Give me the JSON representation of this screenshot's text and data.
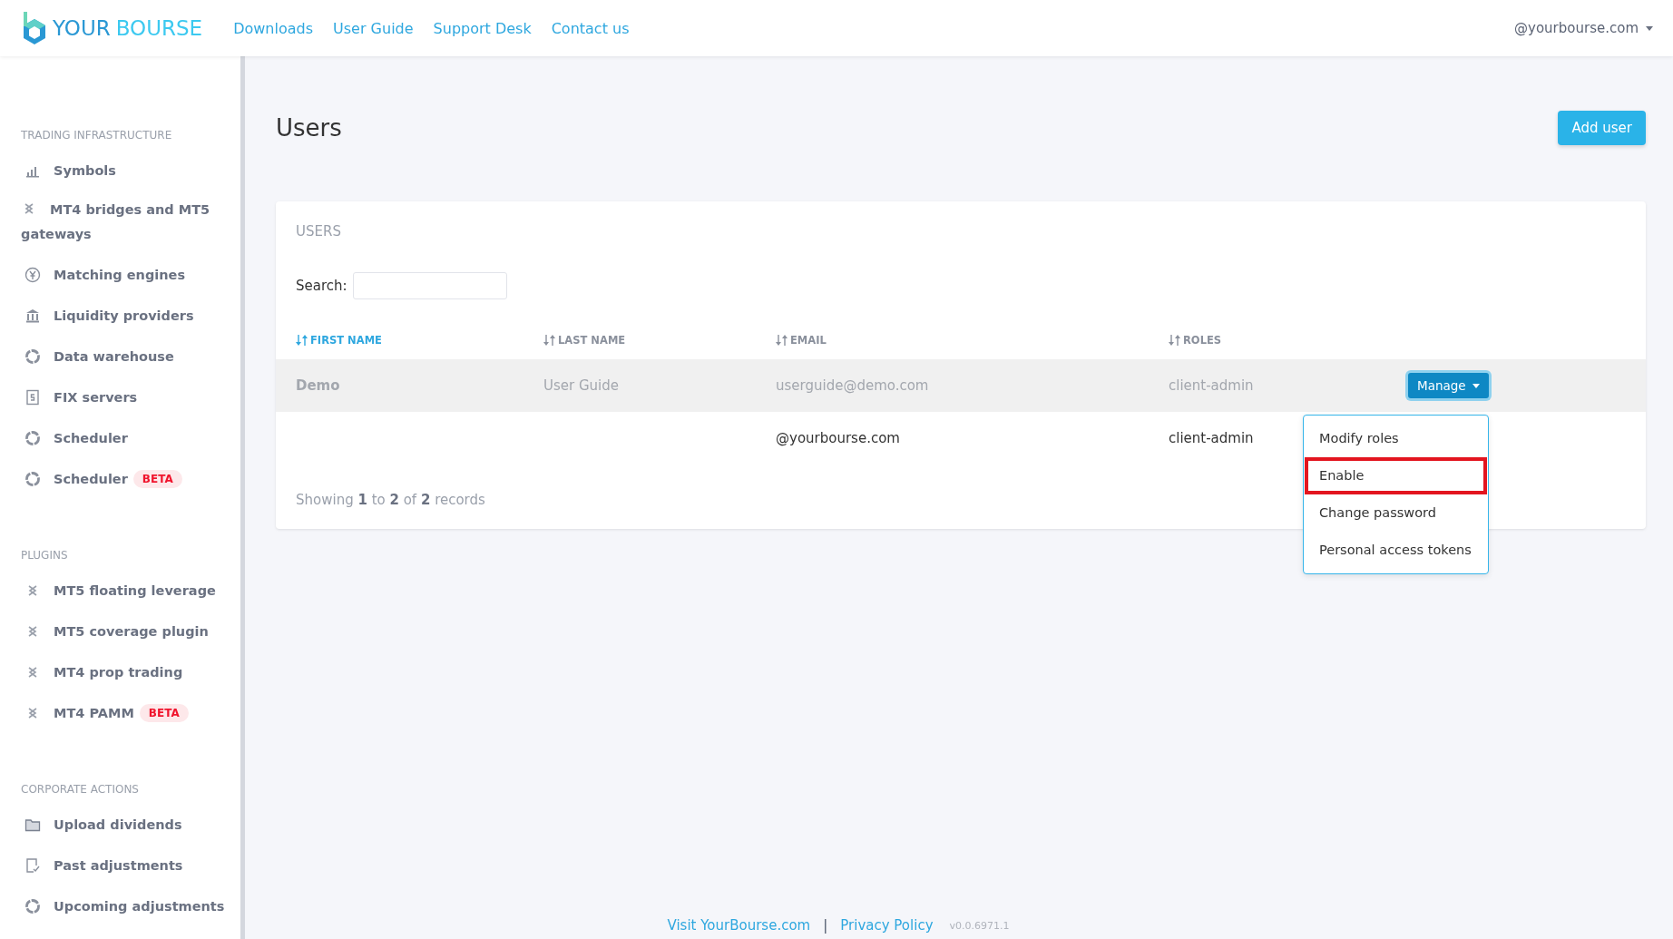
{
  "header": {
    "logo": [
      "YOUR",
      "BOURSE"
    ],
    "nav": [
      "Downloads",
      "User Guide",
      "Support Desk",
      "Contact us"
    ],
    "account": "@yourbourse.com"
  },
  "sidebar": {
    "sections": [
      {
        "title": "TRADING INFRASTRUCTURE",
        "items": [
          {
            "label": "Symbols",
            "kind": "bars"
          },
          {
            "label": "MT4 bridges and MT5 gateways",
            "kind": "link"
          },
          {
            "label": "Matching engines",
            "kind": "yen"
          },
          {
            "label": "Liquidity providers",
            "kind": "bank"
          },
          {
            "label": "Data warehouse",
            "kind": "ring"
          },
          {
            "label": "FIX servers",
            "kind": "doc"
          },
          {
            "label": "Scheduler",
            "kind": "ring"
          },
          {
            "label": "Scheduler",
            "kind": "ring",
            "badge": "BETA"
          }
        ]
      },
      {
        "title": "PLUGINS",
        "items": [
          {
            "label": "MT5 floating leverage",
            "kind": "link"
          },
          {
            "label": "MT5 coverage plugin",
            "kind": "link"
          },
          {
            "label": "MT4 prop trading",
            "kind": "link"
          },
          {
            "label": "MT4 PAMM",
            "kind": "link",
            "badge": "BETA"
          }
        ]
      },
      {
        "title": "CORPORATE ACTIONS",
        "items": [
          {
            "label": "Upload dividends",
            "kind": "folder"
          },
          {
            "label": "Past adjustments",
            "kind": "check"
          },
          {
            "label": "Upcoming adjustments",
            "kind": "ring"
          }
        ]
      }
    ]
  },
  "page": {
    "title": "Users",
    "add_button": "Add user"
  },
  "card": {
    "title": "USERS",
    "search_label": "Search:",
    "columns": [
      {
        "label": "FIRST NAME",
        "selected": true
      },
      {
        "label": "LAST NAME",
        "selected": false
      },
      {
        "label": "EMAIL",
        "selected": false
      },
      {
        "label": "ROLES",
        "selected": false
      }
    ],
    "rows": [
      {
        "cells": [
          "Demo",
          "User Guide",
          "userguide@demo.com",
          "client-admin"
        ],
        "disabled": true,
        "manage": "Manage"
      },
      {
        "cells": [
          "",
          "",
          "@yourbourse.com",
          "client-admin"
        ],
        "disabled": false
      }
    ],
    "footer": [
      "Showing ",
      "1",
      " to ",
      "2",
      " of ",
      "2",
      " records"
    ]
  },
  "menu": {
    "items": [
      {
        "label": "Modify roles",
        "highlighted": false
      },
      {
        "label": "Enable",
        "highlighted": true
      },
      {
        "label": "Change password",
        "highlighted": false
      },
      {
        "label": "Personal access tokens",
        "highlighted": false
      }
    ]
  },
  "footer": {
    "links": [
      "Visit YourBourse.com",
      "Privacy Policy"
    ],
    "separator": "|",
    "version": "v0.0.6971.1"
  }
}
